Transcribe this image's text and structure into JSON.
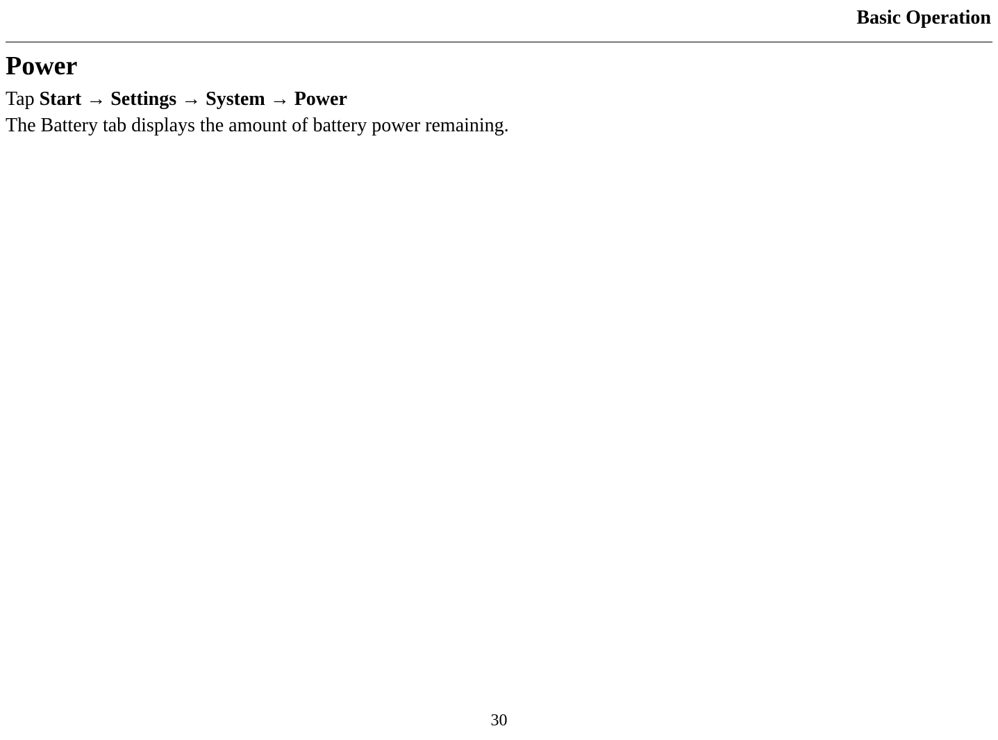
{
  "header": {
    "title": "Basic Operation"
  },
  "section": {
    "heading": "Power",
    "tap_label": "Tap ",
    "nav_parts": {
      "start": "Start",
      "settings": "Settings",
      "system": "System",
      "power": "Power"
    },
    "arrow": "→",
    "body_text": "The Battery tab displays the amount of battery power remaining."
  },
  "page_number": "30"
}
